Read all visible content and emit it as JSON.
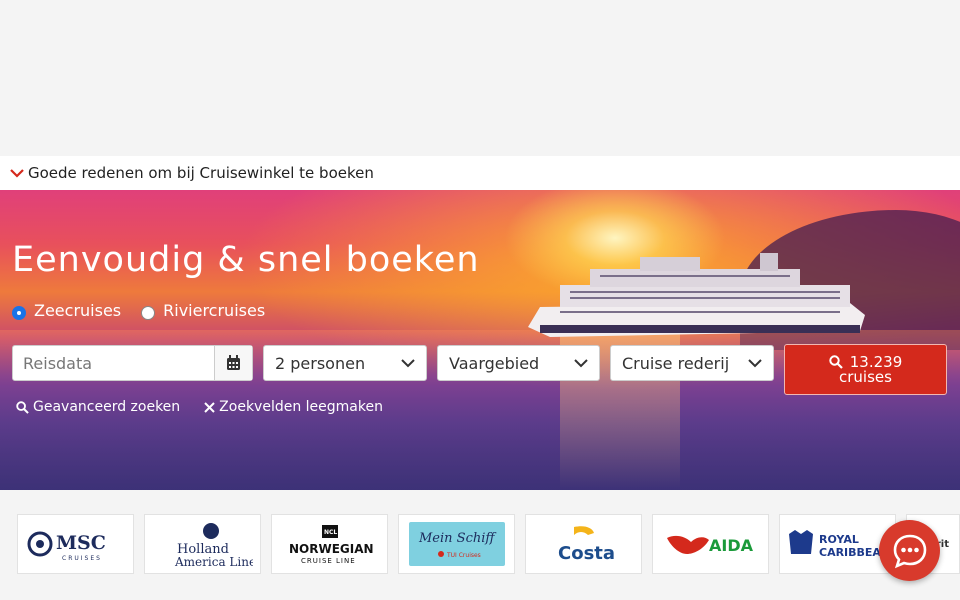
{
  "reasons_bar": {
    "label": "Goede redenen om bij Cruisewinkel te boeken",
    "chevron_icon": "chevron-down-icon",
    "chevron_color": "#d4291c"
  },
  "hero": {
    "title": "Eenvoudig & snel boeken",
    "cruise_types": [
      {
        "label": "Zeecruises",
        "selected": true
      },
      {
        "label": "Riviercruises",
        "selected": false
      }
    ]
  },
  "search": {
    "date_placeholder": "Reisdata",
    "calendar_icon": "calendar-icon",
    "persons_value": "2 personen",
    "area_value": "Vaargebied",
    "line_value": "Cruise rederij",
    "button_count": "13.239",
    "button_suffix": "cruises",
    "button_color": "#d4291c",
    "advanced_label": "Geavanceerd zoeken",
    "clear_label": "Zoekvelden leegmaken"
  },
  "brands": [
    {
      "name": "MSC",
      "sub": "CRUISES"
    },
    {
      "name": "Holland",
      "sub": "America Line"
    },
    {
      "name": "NORWEGIAN",
      "sub": "CRUISE LINE",
      "badge": "NCL"
    },
    {
      "name": "Mein Schiff",
      "sub": "TUI Cruises"
    },
    {
      "name": "Costa"
    },
    {
      "name": "AIDA"
    },
    {
      "name": "ROYAL",
      "sub": "CARIBBEAN"
    },
    {
      "name": "rit"
    }
  ],
  "chat": {
    "icon": "chat-bubble-icon"
  }
}
